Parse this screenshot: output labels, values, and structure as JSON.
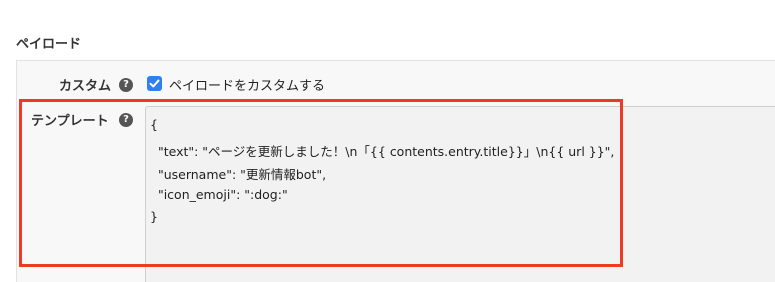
{
  "section": {
    "title": "ペイロード"
  },
  "custom_row": {
    "label": "カスタム",
    "help": "?",
    "checkbox_checked": true,
    "checkbox_label": "ペイロードをカスタムする"
  },
  "template_row": {
    "label": "テンプレート",
    "help": "?",
    "lines": [
      "{",
      "  \"text\": \"ページを更新しました！\\n「{{ contents.entry.title}}」\\n{{ url }}\",",
      "  \"username\": \"更新情報bot\",",
      "  \"icon_emoji\": \":dog:\"",
      "}"
    ]
  },
  "colors": {
    "accent": "#2f80ed",
    "highlight": "#ee3a25"
  }
}
